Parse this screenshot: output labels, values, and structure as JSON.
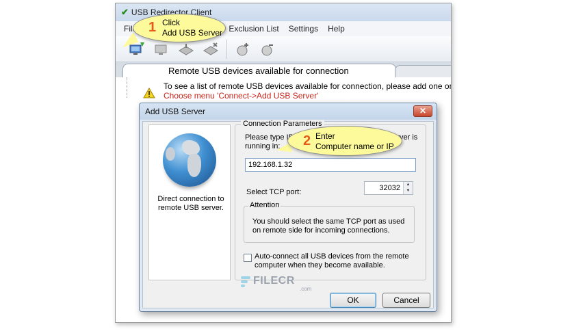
{
  "app": {
    "title": "USB Redirector Client",
    "menu": [
      "File",
      "Exclusion List",
      "Settings",
      "Help"
    ],
    "tab_title": "Remote USB devices available for connection",
    "message_line1": "To see a list of remote USB devices available for connection, please add one or more",
    "message_line2": "Choose menu 'Connect->Add USB Server'"
  },
  "callouts": {
    "step1_number": "1",
    "step1_line1": "Click",
    "step1_line2": "Add USB Server",
    "step2_number": "2",
    "step2_line1": "Enter",
    "step2_line2": "Computer name or IP"
  },
  "dialog": {
    "title": "Add USB Server",
    "close_glyph": "✕",
    "left_text": "Direct connection to remote USB server.",
    "group_label": "Connection Parameters",
    "prompt_text": "Please type IP address or computer where server is running in:",
    "ip_value": "192.168.1.32",
    "tcp_label": "Select TCP port:",
    "tcp_port": "32032",
    "attention_label": "Attention",
    "attention_text": "You should select the same TCP port as used on remote side for incoming connections.",
    "autoconnect_label": "Auto-connect all USB devices from the remote computer when they become available.",
    "ok_label": "OK",
    "cancel_label": "Cancel"
  },
  "watermark": {
    "brand": "FILECR",
    "suffix": ".com"
  },
  "icons": {
    "app": "checkmark-icon",
    "toolbar": [
      "add-server-icon",
      "server-icon",
      "connect-icon",
      "disconnect-icon",
      "add-exclusion-icon",
      "remove-exclusion-icon"
    ]
  },
  "colors": {
    "callout_fill": "#fdfa9c",
    "step_number": "#e65c1a",
    "error_text": "#c8221a"
  }
}
